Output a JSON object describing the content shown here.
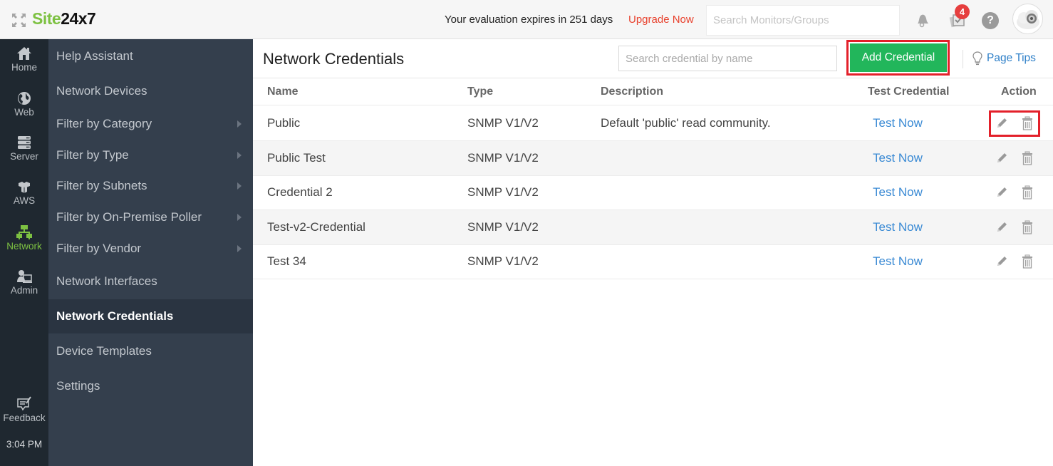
{
  "header": {
    "logo_site": "Site",
    "logo_num": "24x7",
    "evaluation_text": "Your evaluation expires in 251 days",
    "upgrade_label": "Upgrade Now",
    "search_placeholder": "Search Monitors/Groups",
    "alarm_badge_count": "4",
    "help_label": "?",
    "icons": [
      "expand-icon",
      "bell-icon",
      "alarms-icon",
      "help-icon",
      "avatar"
    ]
  },
  "rail": {
    "items": [
      {
        "label": "Home",
        "icon": "home-icon"
      },
      {
        "label": "Web",
        "icon": "globe-icon"
      },
      {
        "label": "Server",
        "icon": "server-icon"
      },
      {
        "label": "AWS",
        "icon": "aws-icon"
      },
      {
        "label": "Network",
        "icon": "network-icon",
        "active": true
      },
      {
        "label": "Admin",
        "icon": "admin-icon"
      }
    ],
    "feedback_label": "Feedback",
    "time": "3:04 PM"
  },
  "subnav": {
    "items": [
      {
        "label": "Help Assistant"
      },
      {
        "label": "Network Devices"
      },
      {
        "label": "Filter by Category",
        "submenu": true
      },
      {
        "label": "Filter by Type",
        "submenu": true
      },
      {
        "label": "Filter by Subnets",
        "submenu": true
      },
      {
        "label": "Filter by On-Premise Poller",
        "submenu": true
      },
      {
        "label": "Filter by Vendor",
        "submenu": true
      },
      {
        "label": "Network Interfaces"
      },
      {
        "label": "Network Credentials",
        "active": true
      },
      {
        "label": "Device Templates"
      },
      {
        "label": "Settings"
      }
    ]
  },
  "main": {
    "title": "Network Credentials",
    "search_placeholder": "Search credential by name",
    "add_button_label": "Add Credential",
    "page_tips_label": "Page Tips",
    "table": {
      "columns": [
        "Name",
        "Type",
        "Description",
        "Test Credential",
        "Action"
      ],
      "rows": [
        {
          "name": "Public",
          "type": "SNMP V1/V2",
          "description": "Default 'public' read community.",
          "test": "Test Now"
        },
        {
          "name": "Public Test",
          "type": "SNMP V1/V2",
          "description": "",
          "test": "Test Now"
        },
        {
          "name": "Credential 2",
          "type": "SNMP V1/V2",
          "description": "",
          "test": "Test Now"
        },
        {
          "name": "Test-v2-Credential",
          "type": "SNMP V1/V2",
          "description": "",
          "test": "Test Now"
        },
        {
          "name": "Test 34",
          "type": "SNMP V1/V2",
          "description": "",
          "test": "Test Now"
        }
      ]
    }
  },
  "colors": {
    "brand_green": "#7dc142",
    "add_button": "#22b65b",
    "link_blue": "#3a8ad4",
    "upgrade_red": "#e8422e",
    "highlight_red": "#e3202a",
    "rail_bg": "#1f2830",
    "subnav_bg": "#343f4d"
  }
}
